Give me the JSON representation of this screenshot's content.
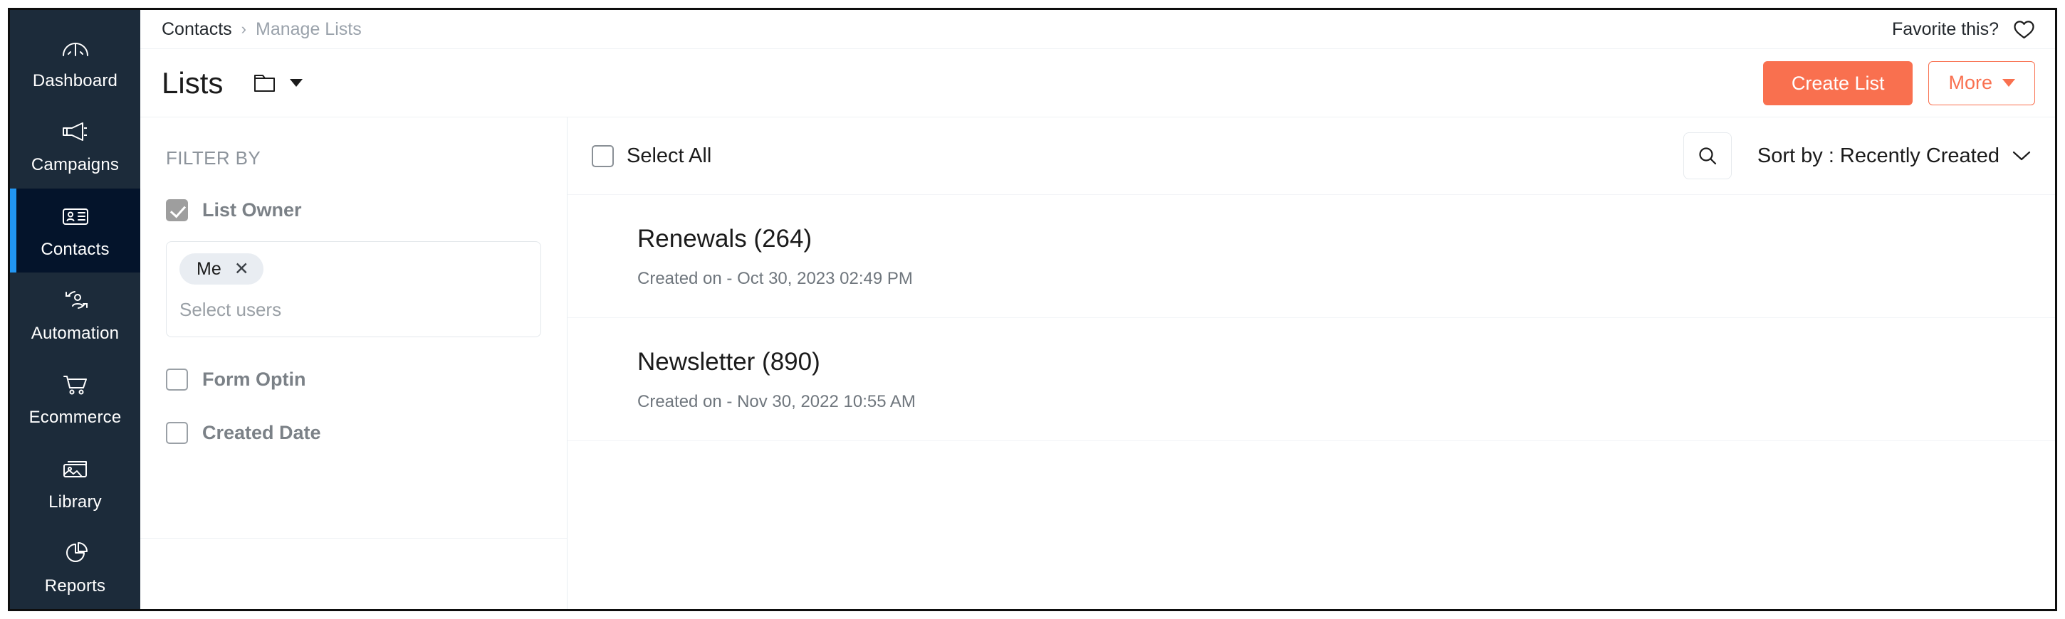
{
  "sidebar": {
    "items": [
      {
        "label": "Dashboard",
        "icon": "gauge-icon",
        "active": false
      },
      {
        "label": "Campaigns",
        "icon": "megaphone-icon",
        "active": false
      },
      {
        "label": "Contacts",
        "icon": "contact-card-icon",
        "active": true
      },
      {
        "label": "Automation",
        "icon": "automation-icon",
        "active": false
      },
      {
        "label": "Ecommerce",
        "icon": "cart-icon",
        "active": false
      },
      {
        "label": "Library",
        "icon": "image-icon",
        "active": false
      },
      {
        "label": "Reports",
        "icon": "pie-chart-icon",
        "active": false
      }
    ]
  },
  "breadcrumb": {
    "root": "Contacts",
    "separator": "›",
    "current": "Manage Lists"
  },
  "favorite": {
    "label": "Favorite this?",
    "icon": "heart-icon"
  },
  "header": {
    "title": "Lists",
    "folder_icon": "folder-icon",
    "create_label": "Create List",
    "more_label": "More",
    "accent_color": "#f9704f"
  },
  "filters": {
    "heading": "FILTER BY",
    "options": [
      {
        "label": "List Owner",
        "checked": true
      },
      {
        "label": "Form Optin",
        "checked": false
      },
      {
        "label": "Created Date",
        "checked": false
      }
    ],
    "user_select": {
      "chips": [
        {
          "label": "Me",
          "remove_icon": "✕"
        }
      ],
      "placeholder": "Select users"
    }
  },
  "list_toolbar": {
    "select_all_label": "Select All",
    "select_all_checked": false,
    "search_icon": "search-icon",
    "sort_label": "Sort by : Recently Created"
  },
  "lists": [
    {
      "name": "Renewals (264)",
      "created": "Created on - Oct 30, 2023 02:49 PM"
    },
    {
      "name": "Newsletter (890)",
      "created": "Created on - Nov 30, 2022 10:55 AM"
    }
  ]
}
